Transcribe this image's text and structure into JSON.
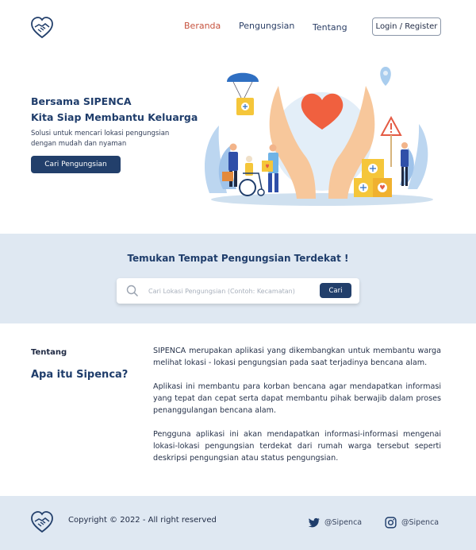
{
  "nav": {
    "links": [
      "Beranda",
      "Pengungsian",
      "Tentang"
    ],
    "login_label": "Login / Register"
  },
  "hero": {
    "title_line1": "Bersama SIPENCA",
    "title_line2": "Kita Siap Membantu Keluarga",
    "subtitle_line1": "Solusi untuk mencari lokasi pengungsian",
    "subtitle_line2": "dengan mudah dan nyaman",
    "cta_label": "Cari Pengungsian"
  },
  "search": {
    "heading": "Temukan Tempat Pengungsian Terdekat !",
    "placeholder": "Cari Lokasi Pengungsian (Contoh: Kecamatan)",
    "button_label": "Cari"
  },
  "about": {
    "label": "Tentang",
    "title": "Apa itu Sipenca?",
    "paragraphs": [
      "SIPENCA merupakan aplikasi yang dikembangkan untuk membantu warga melihat lokasi - lokasi pengungsian pada saat terjadinya bencana alam.",
      "Aplikasi ini membantu para korban bencana agar mendapatkan informasi yang tepat dan cepat serta dapat membantu pihak berwajib dalam proses penanggulangan bencana alam.",
      "Pengguna aplikasi ini akan mendapatkan informasi-informasi mengenai lokasi-lokasi pengungsian terdekat dari rumah warga tersebut seperti deskripsi pengungsian atau status pengungsian."
    ]
  },
  "footer": {
    "copyright": "Copyright © 2022 - All right reserved",
    "twitter_handle": "@Sipenca",
    "instagram_handle": "@Sipenca"
  },
  "colors": {
    "primary": "#223f6b",
    "accent": "#c6533f",
    "band": "#dfe8f2"
  }
}
